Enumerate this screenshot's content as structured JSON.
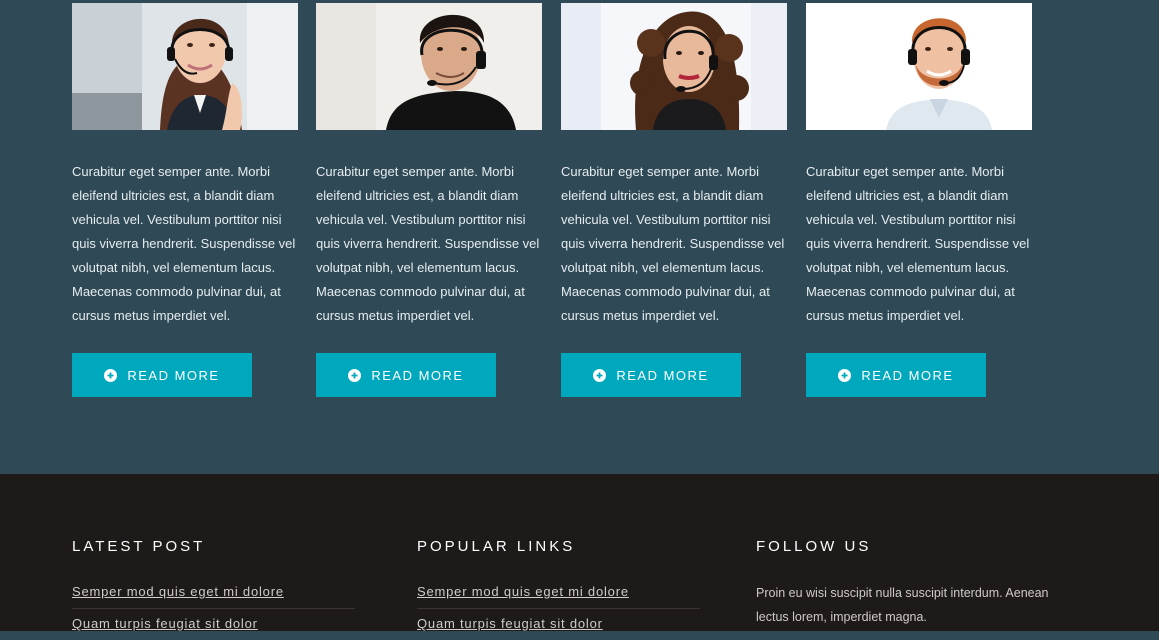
{
  "team": {
    "cards": [
      {
        "photo_icon": "woman-headset-photo",
        "text": "Curabitur eget semper ante. Morbi eleifend ultricies est, a blandit diam vehicula vel. Vestibulum porttitor nisi quis viverra hendrerit. Suspendisse vel volutpat nibh, vel elementum lacus. Maecenas commodo pulvinar dui, at cursus metus imperdiet vel.",
        "button_label": "READ MORE"
      },
      {
        "photo_icon": "man-headset-photo",
        "text": "Curabitur eget semper ante. Morbi eleifend ultricies est, a blandit diam vehicula vel. Vestibulum porttitor nisi quis viverra hendrerit. Suspendisse vel volutpat nibh, vel elementum lacus. Maecenas commodo pulvinar dui, at cursus metus imperdiet vel.",
        "button_label": "READ MORE"
      },
      {
        "photo_icon": "curly-woman-headset-photo",
        "text": "Curabitur eget semper ante. Morbi eleifend ultricies est, a blandit diam vehicula vel. Vestibulum porttitor nisi quis viverra hendrerit. Suspendisse vel volutpat nibh, vel elementum lacus. Maecenas commodo pulvinar dui, at cursus metus imperdiet vel.",
        "button_label": "READ MORE"
      },
      {
        "photo_icon": "redhead-man-headset-photo",
        "text": "Curabitur eget semper ante. Morbi eleifend ultricies est, a blandit diam vehicula vel. Vestibulum porttitor nisi quis viverra hendrerit. Suspendisse vel volutpat nibh, vel elementum lacus. Maecenas commodo pulvinar dui, at cursus metus imperdiet vel.",
        "button_label": "READ MORE"
      }
    ],
    "button_icon": "plus-circle-icon"
  },
  "footer": {
    "latest_post": {
      "heading": "LATEST POST",
      "links": [
        "Semper mod quis eget mi dolore",
        "Quam turpis feugiat sit dolor"
      ]
    },
    "popular_links": {
      "heading": "POPULAR LINKS",
      "links": [
        "Semper mod quis eget mi dolore",
        "Quam turpis feugiat sit dolor"
      ]
    },
    "follow_us": {
      "heading": "FOLLOW US",
      "text": "Proin eu wisi suscipit nulla suscipit interdum. Aenean lectus lorem, imperdiet magna."
    }
  },
  "colors": {
    "section_bg": "#2f4a56",
    "footer_bg": "#1e1a19",
    "button_bg": "#00a8bd",
    "text_light": "#e6ecef"
  }
}
